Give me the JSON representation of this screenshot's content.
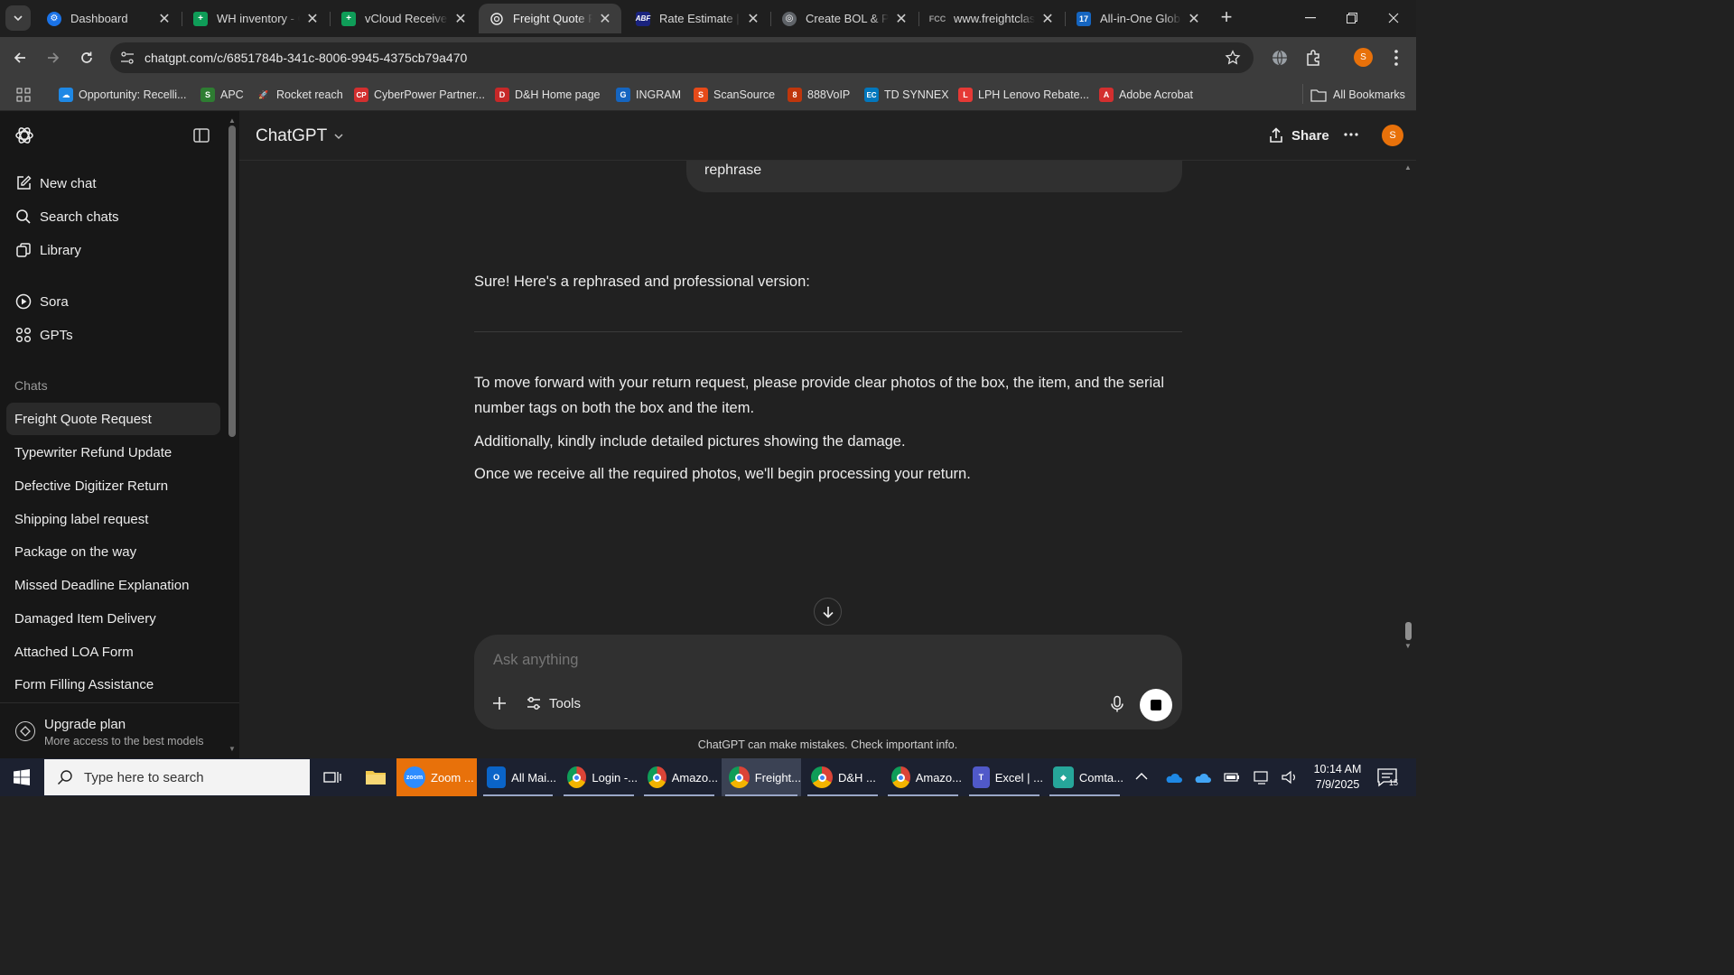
{
  "browser": {
    "tabs": [
      {
        "title": "Dashboard",
        "favicon": "gear-favicon",
        "color": "#1a73e8"
      },
      {
        "title": "WH inventory - G",
        "favicon": "sheets-favicon",
        "color": "#0f9d58"
      },
      {
        "title": "vCloud Receive F",
        "favicon": "sheets-favicon",
        "color": "#0f9d58"
      },
      {
        "title": "Freight Quote Re",
        "favicon": "chatgpt-favicon",
        "color": "#ffffff"
      },
      {
        "title": "Rate Estimate | A",
        "favicon": "abf-favicon",
        "color": "#c62828"
      },
      {
        "title": "Create BOL & Pi",
        "favicon": "globe-favicon",
        "color": "#888888"
      },
      {
        "title": "www.freightclass",
        "favicon": "fcc-favicon",
        "color": "#777777"
      },
      {
        "title": "All-in-One Globa",
        "favicon": "17track-favicon",
        "color": "#1565c0"
      }
    ],
    "url": "chatgpt.com/c/6851784b-341c-8006-9945-4375cb79a470",
    "profile_initial": "S",
    "bookmarks": [
      {
        "label": "Opportunity: Recelli...",
        "color": "#1e88e5",
        "icon_text": "☁"
      },
      {
        "label": "APC",
        "color": "#2e7d32",
        "icon_text": "S"
      },
      {
        "label": "Rocket reach",
        "color": "#9e9e9e",
        "icon_text": "🚀"
      },
      {
        "label": "CyberPower Partner...",
        "color": "#d32f2f",
        "icon_text": "CP"
      },
      {
        "label": "D&H Home page",
        "color": "#c62828",
        "icon_text": "D"
      },
      {
        "label": "INGRAM",
        "color": "#1565c0",
        "icon_text": "G"
      },
      {
        "label": "ScanSource",
        "color": "#e64a19",
        "icon_text": "S"
      },
      {
        "label": "888VoIP",
        "color": "#bf360c",
        "icon_text": "8"
      },
      {
        "label": "TD SYNNEX",
        "color": "#0277bd",
        "icon_text": "EC"
      },
      {
        "label": "LPH Lenovo Rebate...",
        "color": "#e53935",
        "icon_text": "L"
      },
      {
        "label": "Adobe Acrobat",
        "color": "#d32f2f",
        "icon_text": "A"
      }
    ],
    "all_bookmarks_label": "All Bookmarks"
  },
  "sidebar": {
    "nav": [
      {
        "label": "New chat",
        "icon": "new-chat-icon"
      },
      {
        "label": "Search chats",
        "icon": "search-icon"
      },
      {
        "label": "Library",
        "icon": "library-icon"
      },
      {
        "label": "Sora",
        "icon": "sora-icon"
      },
      {
        "label": "GPTs",
        "icon": "gpts-icon"
      }
    ],
    "chats_heading": "Chats",
    "chats": [
      "Freight Quote Request",
      "Typewriter Refund Update",
      "Defective Digitizer Return",
      "Shipping label request",
      "Package on the way",
      "Missed Deadline Explanation",
      "Damaged Item Delivery",
      "Attached LOA Form",
      "Form Filling Assistance"
    ],
    "upgrade_title": "Upgrade plan",
    "upgrade_subtitle": "More access to the best models"
  },
  "header": {
    "model": "ChatGPT",
    "share_label": "Share",
    "avatar_initial": "S"
  },
  "conversation": {
    "user_message": "rephrase",
    "assistant_intro": "Sure! Here's a rephrased and professional version:",
    "assistant_paragraphs": [
      "To move forward with your return request, please provide clear photos of the box, the item, and the serial number tags on both the box and the item.",
      "Additionally, kindly include detailed pictures showing the damage.",
      "Once we receive all the required photos, we'll begin processing your return."
    ]
  },
  "composer": {
    "placeholder": "Ask anything",
    "tools_label": "Tools",
    "disclaimer": "ChatGPT can make mistakes. Check important info."
  },
  "taskbar": {
    "search_placeholder": "Type here to search",
    "apps": [
      {
        "label": "Zoom ...",
        "color": "#2d8cff",
        "icon_text": "zoom"
      },
      {
        "label": "All Mai...",
        "color": "#0a64c8",
        "icon_text": "O"
      },
      {
        "label": "Login -...",
        "color": "#db4437",
        "icon_text": "●"
      },
      {
        "label": "Amazo...",
        "color": "#db4437",
        "icon_text": "●"
      },
      {
        "label": "Freight...",
        "color": "#db4437",
        "icon_text": "●"
      },
      {
        "label": "D&H ...",
        "color": "#db4437",
        "icon_text": "●"
      },
      {
        "label": "Amazo...",
        "color": "#db4437",
        "icon_text": "●"
      },
      {
        "label": "Excel | ...",
        "color": "#5059c9",
        "icon_text": "T"
      },
      {
        "label": "Comta...",
        "color": "#26a69a",
        "icon_text": "◆"
      }
    ],
    "time": "10:14 AM",
    "date": "7/9/2025",
    "notification_count": "15"
  }
}
